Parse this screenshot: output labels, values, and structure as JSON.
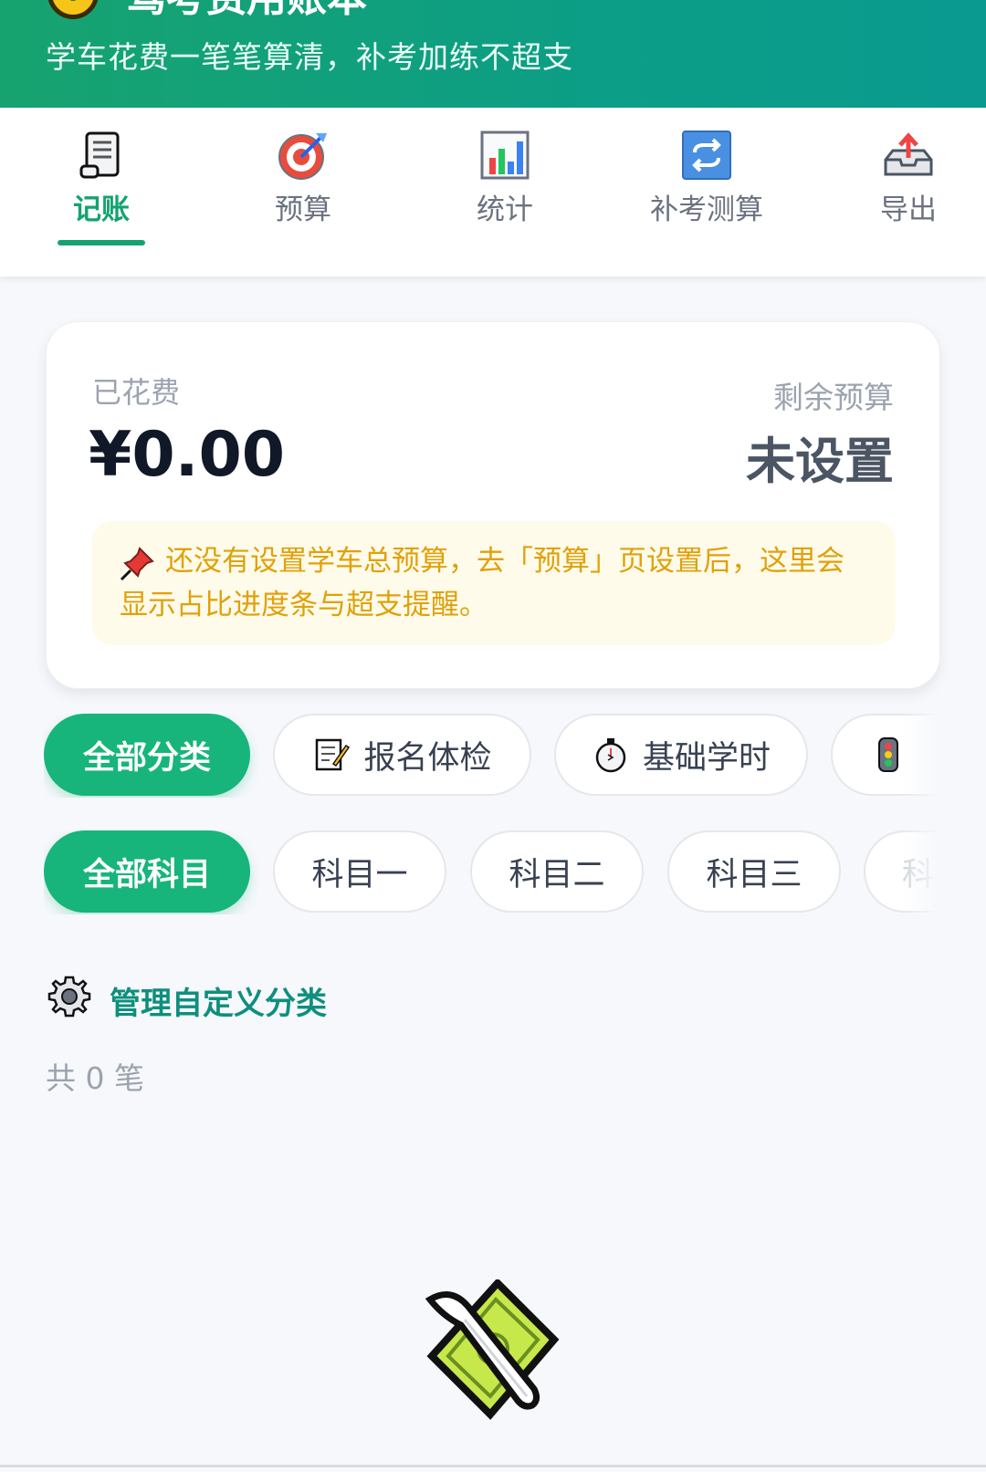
{
  "header": {
    "title": "驾考费用账本",
    "subtitle": "学车花费一笔笔算清，补考加练不超支"
  },
  "tabs": [
    {
      "label": "记账",
      "icon": "scroll-icon",
      "active": true
    },
    {
      "label": "预算",
      "icon": "target-icon",
      "active": false
    },
    {
      "label": "统计",
      "icon": "bar-chart-icon",
      "active": false
    },
    {
      "label": "补考测算",
      "icon": "repeat-icon",
      "active": false
    },
    {
      "label": "导出",
      "icon": "upload-tray-icon",
      "active": false
    }
  ],
  "summary": {
    "spent_label": "已花费",
    "spent_value": "¥0.00",
    "remain_label": "剩余预算",
    "remain_value": "未设置",
    "notice": "还没有设置学车总预算，去「预算」页设置后，这里会显示占比进度条与超支提醒。"
  },
  "category_chips": [
    {
      "label": "全部分类",
      "icon": "",
      "active": true
    },
    {
      "label": "报名体检",
      "icon": "memo-icon",
      "active": false
    },
    {
      "label": "基础学时",
      "icon": "stopwatch-icon",
      "active": false
    },
    {
      "label": "",
      "icon": "traffic-light-icon",
      "active": false
    }
  ],
  "subject_chips": [
    {
      "label": "全部科目",
      "active": true
    },
    {
      "label": "科目一",
      "active": false
    },
    {
      "label": "科目二",
      "active": false
    },
    {
      "label": "科目三",
      "active": false
    },
    {
      "label": "科",
      "active": false
    }
  ],
  "manage_label": "管理自定义分类",
  "count_text": "共 0 笔",
  "colors": {
    "brand": "#14a36f",
    "chip_active": "#17b57b",
    "notice_text": "#e0a10a",
    "notice_bg": "#fffbea"
  }
}
